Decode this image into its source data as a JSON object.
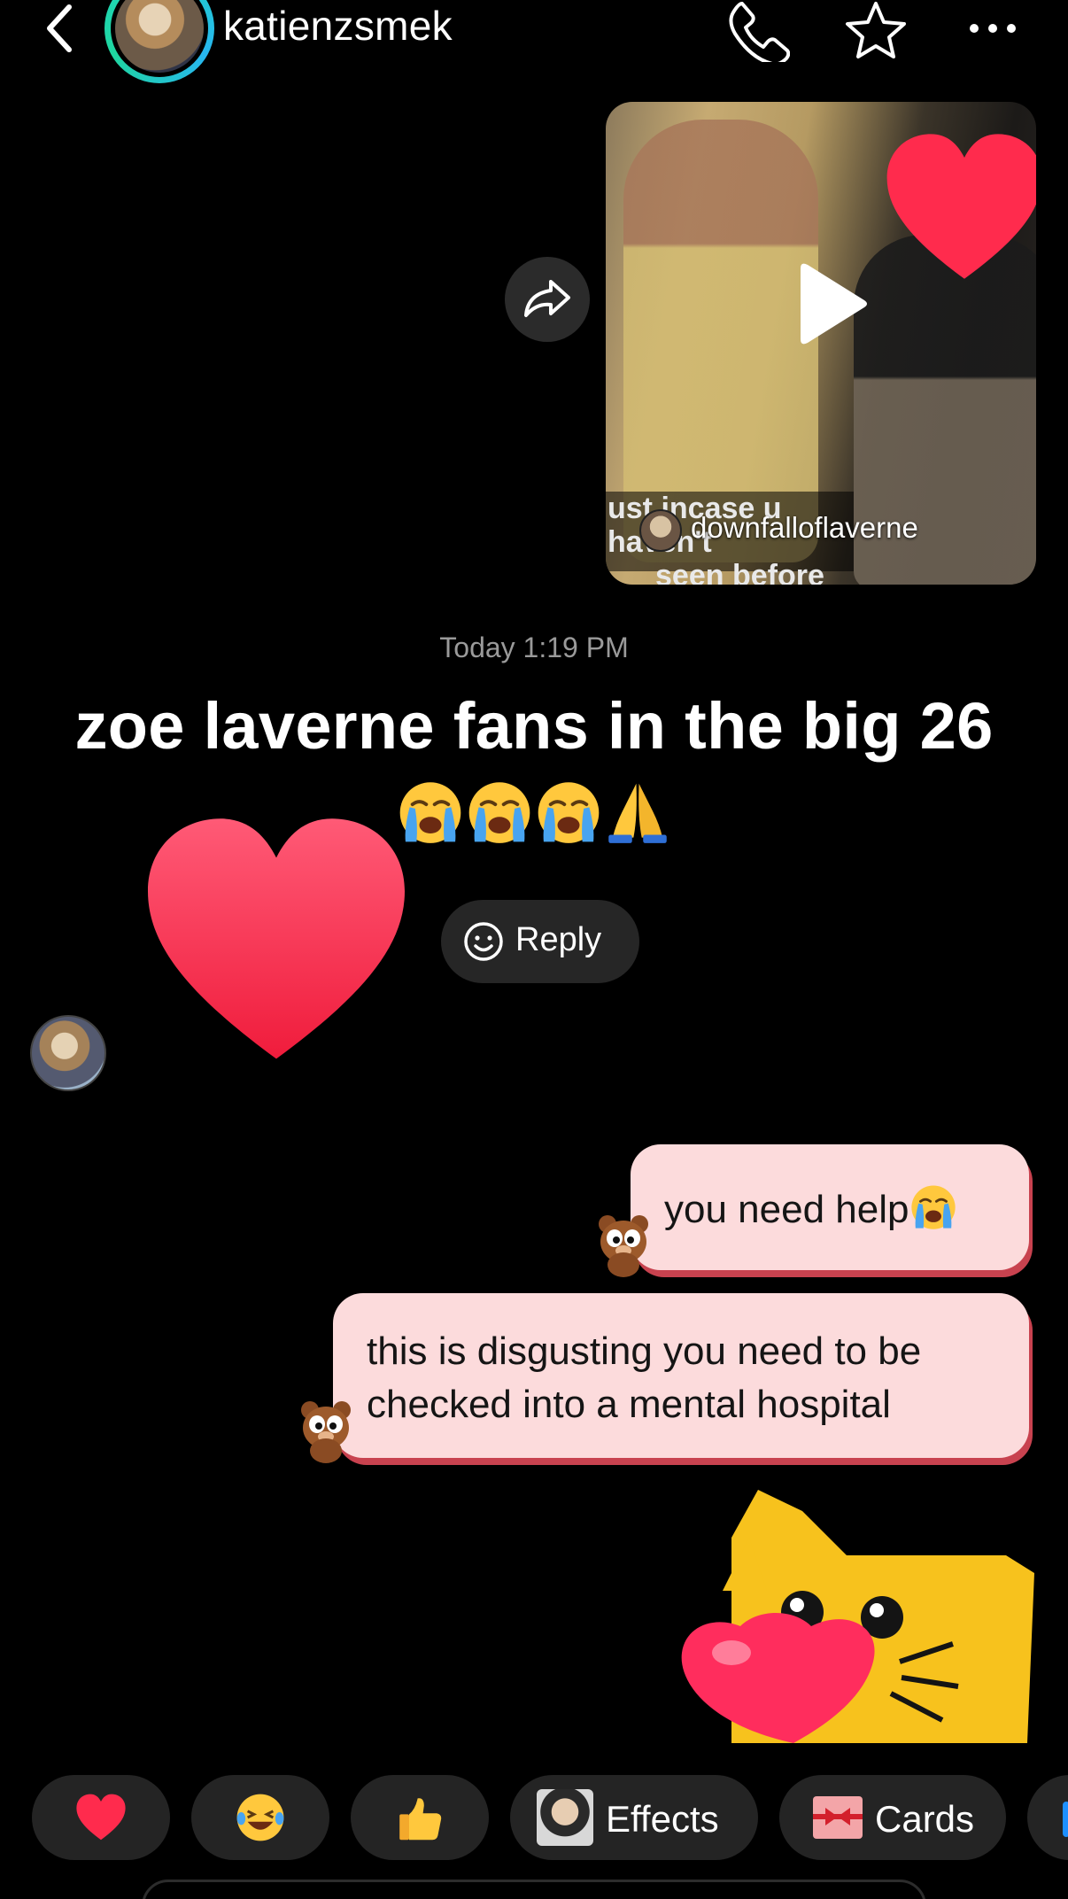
{
  "header": {
    "username": "katienzsmek",
    "back_icon": "chevron-left-icon",
    "call_icon": "phone-icon",
    "favorite_icon": "star-icon",
    "more_icon": "ellipsis-icon"
  },
  "shared_video": {
    "caption_line1": "ust incase u haven't",
    "caption_line2": "seen before",
    "author": "downfalloflaverne",
    "play_icon": "play-icon",
    "share_icon": "share-forward-icon"
  },
  "timestamp": "Today 1:19 PM",
  "incoming_message": {
    "text": "zoe laverne fans in the big 26",
    "emojis": [
      "loudly-crying-face",
      "loudly-crying-face",
      "loudly-crying-face",
      "folded-hands"
    ],
    "reaction": "red-heart",
    "reply_label": "Reply"
  },
  "outgoing_messages": [
    {
      "text": "you need help",
      "emoji": "loudly-crying-face"
    },
    {
      "text_line1": "this is disgusting you need to be",
      "text_line2": "checked into a mental hospital"
    }
  ],
  "sticker": "cat-holding-heart-sticker",
  "quick_bar": {
    "items": [
      {
        "emoji": "red-heart"
      },
      {
        "emoji": "tears-of-joy"
      },
      {
        "emoji": "thumbs-up"
      },
      {
        "label": "Effects"
      },
      {
        "label": "Cards"
      }
    ]
  },
  "colors": {
    "background": "#000000",
    "bubble_fill": "#fcdbdc",
    "bubble_shadow": "#c8424f",
    "pill": "#242424",
    "heart": "#ff2d55"
  }
}
